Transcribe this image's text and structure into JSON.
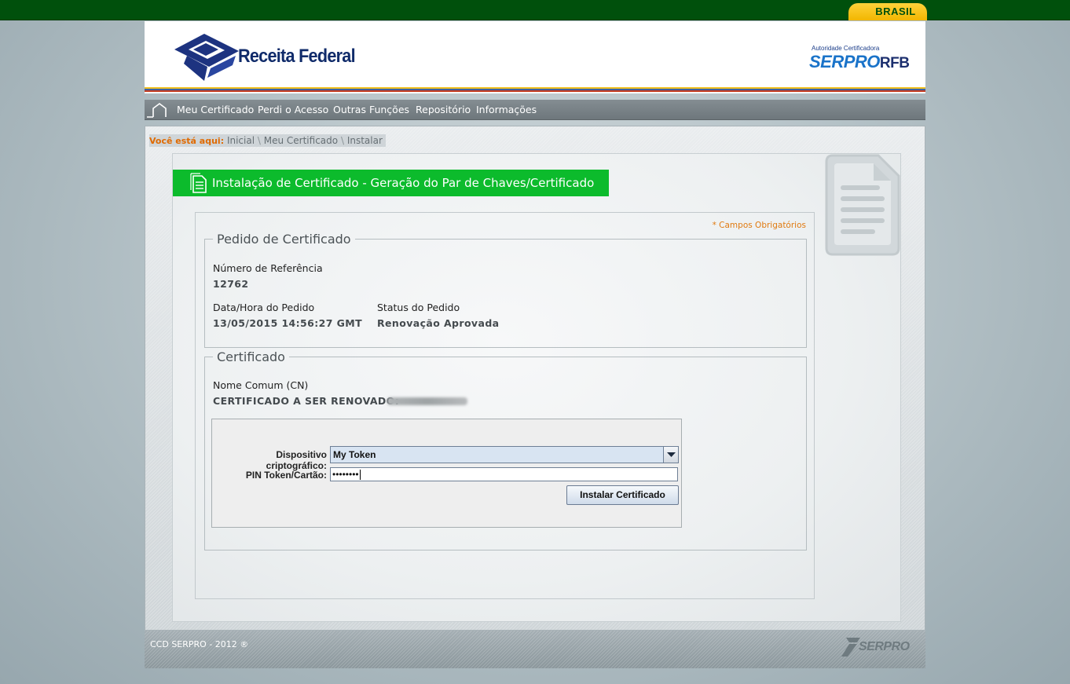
{
  "gov_bar": {
    "brasil_label": "BRASIL"
  },
  "header": {
    "logo_title": "Receita Federal",
    "ac_small": "Autoridade Certificadora",
    "serpro_main": "SERPRO",
    "serpro_rfb": "RFB"
  },
  "nav": {
    "items": [
      "Meu Certificado",
      "Perdi o Acesso",
      "Outras Funções",
      "Repositório",
      "Informações"
    ]
  },
  "breadcrumb": {
    "label": "Você está aqui:",
    "items": [
      "Inicial",
      "Meu Certificado",
      "Instalar"
    ],
    "separator": "\\"
  },
  "page": {
    "title": "Instalação de Certificado - Geração do Par de Chaves/Certificado",
    "required_note": "* Campos Obrigatórios"
  },
  "pedido": {
    "legend": "Pedido de Certificado",
    "ref_label": "Número de Referência",
    "ref_value": "12762",
    "date_label": "Data/Hora do Pedido",
    "date_value": "13/05/2015 14:56:27 GMT",
    "status_label": "Status do Pedido",
    "status_value": "Renovação Aprovada"
  },
  "certificado": {
    "legend": "Certificado",
    "cn_label": "Nome Comum (CN)",
    "cn_value": "CERTIFICADO A SER RENOVADO:"
  },
  "applet": {
    "device_label": "Dispositivo criptográfico:",
    "device_value": "My Token",
    "pin_label": "PIN Token/Cartão:",
    "pin_value": "••••••••",
    "install_button": "Instalar Certificado"
  },
  "footer": {
    "copyright": "CCD SERPRO - 2012 ®",
    "logo_text": "SERPRO"
  },
  "colors": {
    "gov_green": "#00500c",
    "brasil_yellow": "#ffd23a",
    "title_green": "#0cbb2c",
    "breadcrumb_orange": "#e06a00",
    "navy": "#102b6a"
  }
}
